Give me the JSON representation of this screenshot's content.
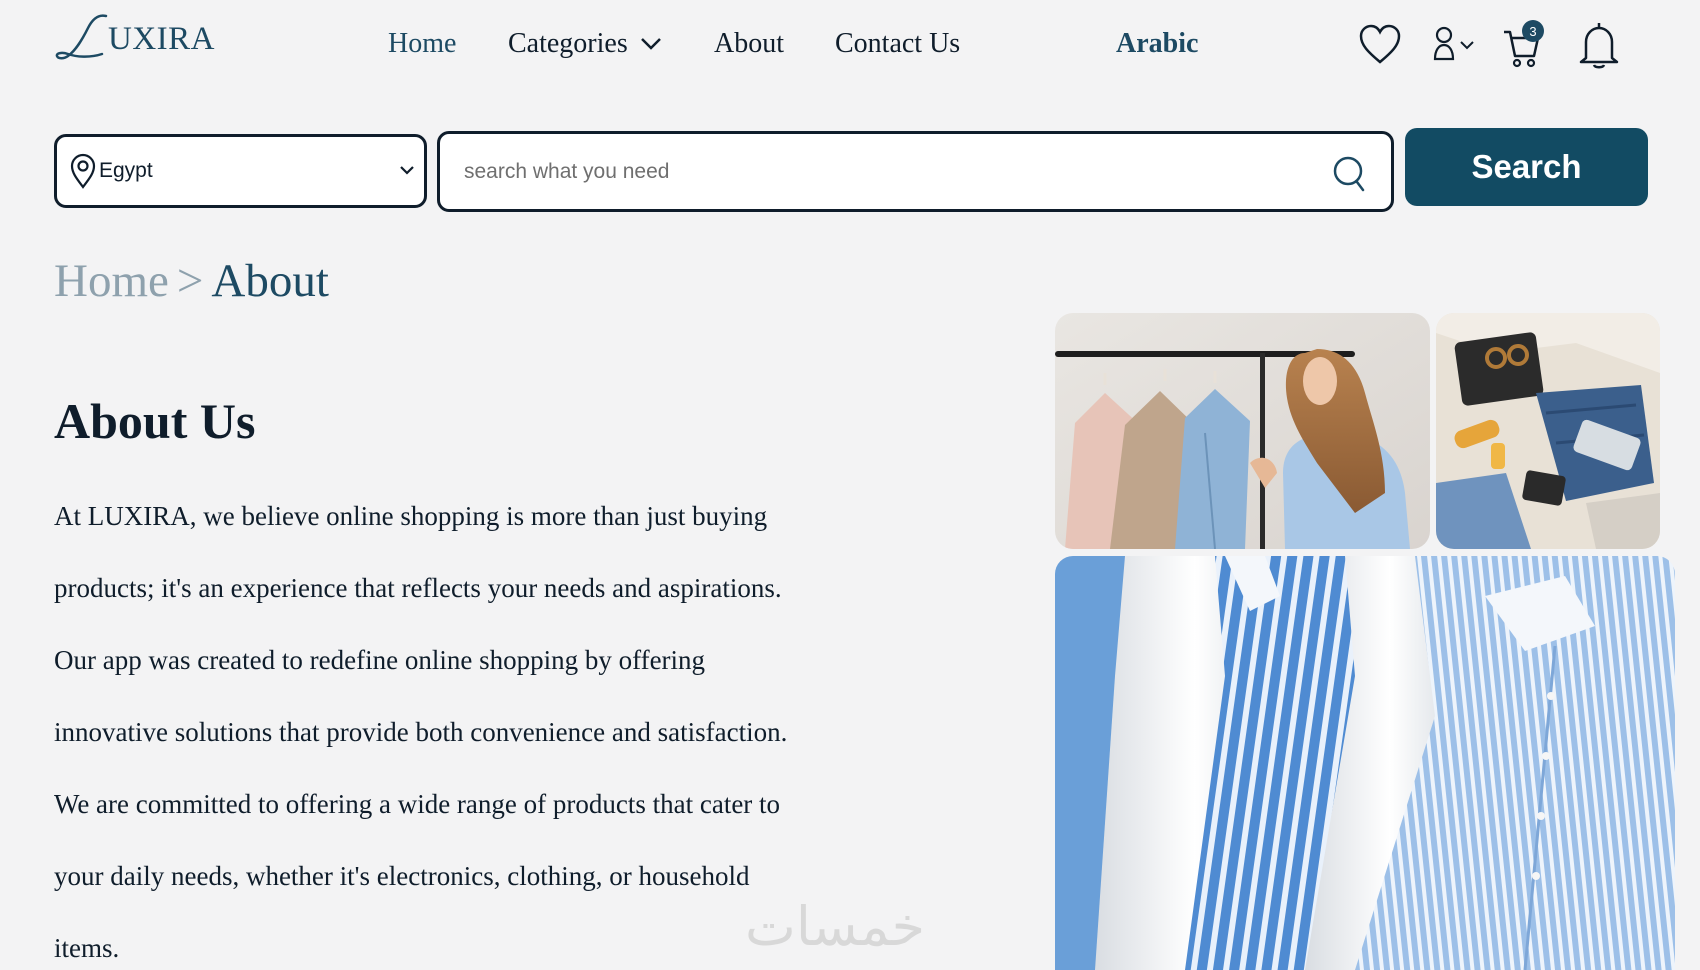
{
  "header": {
    "logo_text": "UXIRA",
    "nav": {
      "home": "Home",
      "categories": "Categories",
      "about": "About",
      "contact": "Contact Us",
      "language": "Arabic"
    },
    "cart_count": "3",
    "icons": [
      "heart-icon",
      "user-icon",
      "chevron-down-icon",
      "cart-icon",
      "bell-icon"
    ]
  },
  "search": {
    "country_selected": "Egypt",
    "placeholder": "search what you need",
    "button_label": "Search"
  },
  "breadcrumb": {
    "home": "Home",
    "separator": ">",
    "current": "About"
  },
  "about": {
    "title": "About Us",
    "lines": [
      "At LUXIRA, we believe online shopping is more than just buying",
      "products; it's an experience that reflects your needs and aspirations.",
      "Our app was created to redefine online shopping by offering",
      "innovative solutions that provide both convenience and satisfaction.",
      "We are committed to offering a wide range of products that cater to",
      "your daily needs, whether it's electronics, clothing, or household",
      "items."
    ]
  },
  "watermark": "خمسات",
  "colors": {
    "brand": "#124b63",
    "text": "#0f1d2b",
    "muted": "#8ea1ad",
    "background": "#f3f3f4"
  }
}
